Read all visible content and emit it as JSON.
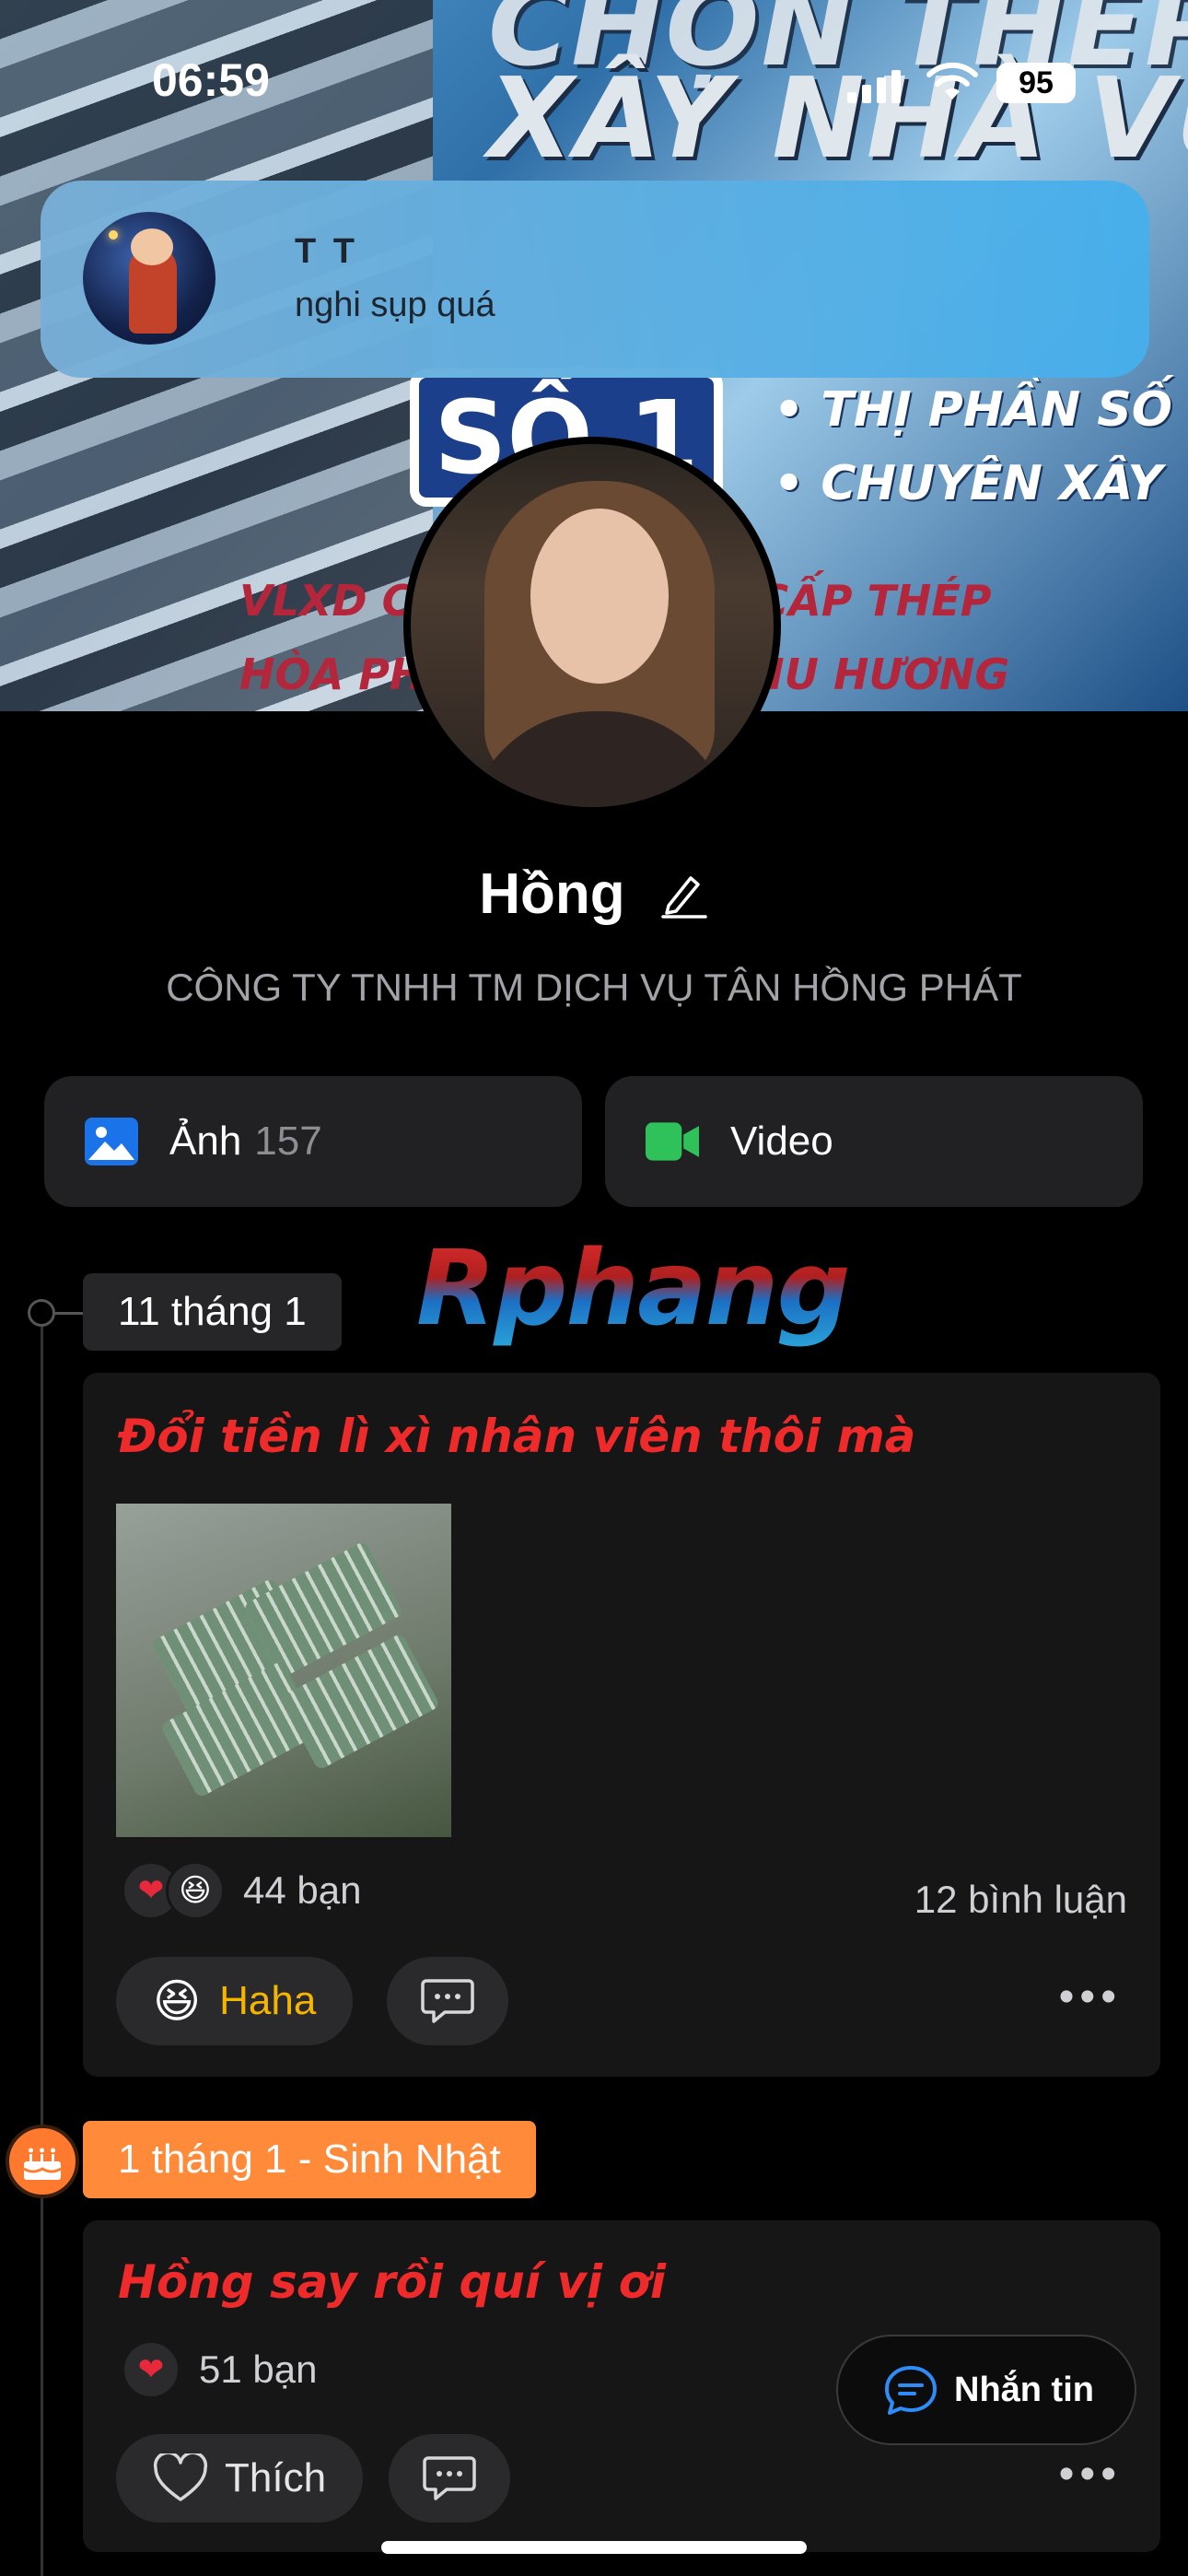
{
  "status_bar": {
    "time": "06:59",
    "battery": "95"
  },
  "notification": {
    "sender": "T T",
    "message": "nghi sụp quá"
  },
  "cover": {
    "headline_top": "CHỌN THÉP C",
    "headline": "XÂY NHÀ VỮNG",
    "badge": "SỐ 1",
    "bullet_1": "• THỊ PHẦN SỐ",
    "bullet_2": "• CHUYÊN XÂY",
    "line_1": "VLXD C                    G CẤP THÉP",
    "line_2": "HÒA PH                    THU HƯƠNG"
  },
  "profile": {
    "name": "Hồng",
    "company": "CÔNG TY TNHH TM DỊCH VỤ TÂN HỒNG PHÁT"
  },
  "media": {
    "photos_label": "Ảnh",
    "photos_count": "157",
    "videos_label": "Video"
  },
  "watermark": "Rphang",
  "timeline": [
    {
      "date": "11 tháng 1",
      "post": {
        "title": "Đổi tiền lì xì nhân viên thôi mà",
        "reaction_count": "44 bạn",
        "comment_count": "12 bình luận",
        "my_reaction": "Haha"
      }
    },
    {
      "date": "1 tháng 1 - Sinh Nhật",
      "post": {
        "title": "Hồng say rồi quí vị ơi",
        "reaction_count": "51 bạn",
        "like_label": "Thích"
      }
    }
  ],
  "message_button": "Nhắn tin",
  "icons": {
    "photos": "image-icon",
    "videos": "video-camera-icon",
    "edit": "pencil-icon",
    "comment": "chat-bubble-icon",
    "more": "ellipsis-icon",
    "birthday": "cake-icon",
    "message": "message-bubble-icon",
    "heart": "heart-icon",
    "haha": "laughing-emoji-icon"
  },
  "colors": {
    "photos_icon": "#1a73e8",
    "video_icon": "#30c25a",
    "post_title": "#ee2a2a",
    "haha_label": "#f5b400",
    "birthday": "#ff8a3a",
    "message_icon": "#2f8cf6"
  }
}
